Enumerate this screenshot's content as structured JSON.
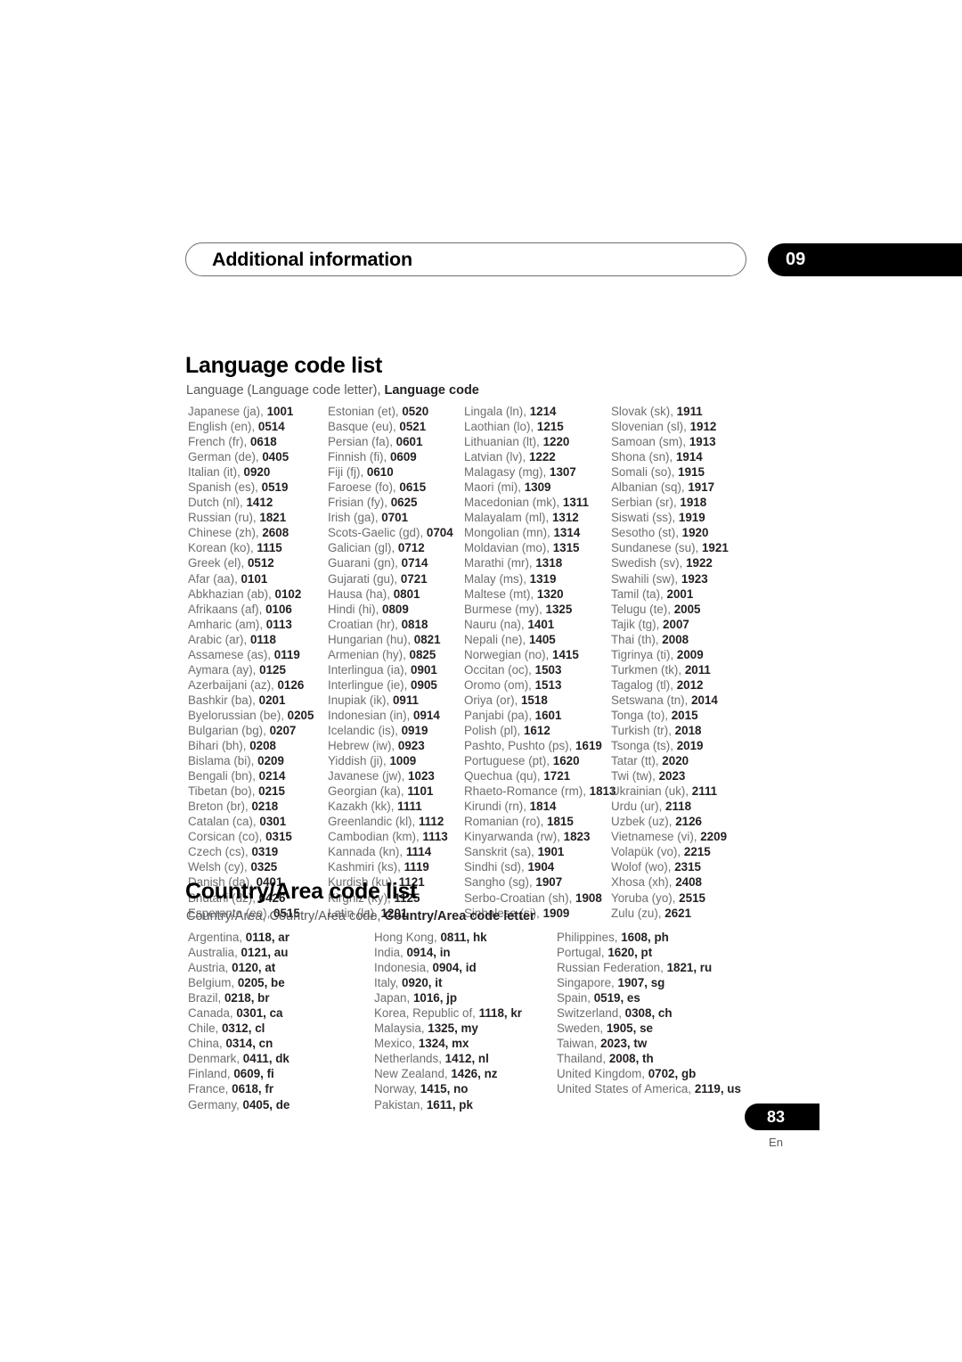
{
  "header": {
    "title": "Additional information",
    "chapter_number": "09"
  },
  "language_section": {
    "heading": "Language code list",
    "subtitle_plain": "Language (Language code letter), ",
    "subtitle_bold": "Language code",
    "columns": [
      [
        {
          "name": "Japanese (ja), ",
          "code": "1001"
        },
        {
          "name": "English (en), ",
          "code": "0514"
        },
        {
          "name": "French (fr), ",
          "code": "0618"
        },
        {
          "name": "German (de), ",
          "code": "0405"
        },
        {
          "name": "Italian (it), ",
          "code": "0920"
        },
        {
          "name": "Spanish (es), ",
          "code": "0519"
        },
        {
          "name": "Dutch (nl), ",
          "code": "1412"
        },
        {
          "name": "Russian (ru), ",
          "code": "1821"
        },
        {
          "name": "Chinese (zh), ",
          "code": "2608"
        },
        {
          "name": "Korean (ko), ",
          "code": "1115"
        },
        {
          "name": "Greek (el), ",
          "code": "0512"
        },
        {
          "name": "Afar (aa), ",
          "code": "0101"
        },
        {
          "name": "Abkhazian (ab), ",
          "code": "0102"
        },
        {
          "name": "Afrikaans (af), ",
          "code": "0106"
        },
        {
          "name": "Amharic (am), ",
          "code": "0113"
        },
        {
          "name": "Arabic (ar), ",
          "code": "0118"
        },
        {
          "name": "Assamese (as), ",
          "code": "0119"
        },
        {
          "name": "Aymara (ay), ",
          "code": "0125"
        },
        {
          "name": "Azerbaijani (az), ",
          "code": "0126"
        },
        {
          "name": "Bashkir (ba), ",
          "code": "0201"
        },
        {
          "name": "Byelorussian (be), ",
          "code": "0205"
        },
        {
          "name": "Bulgarian (bg), ",
          "code": "0207"
        },
        {
          "name": "Bihari (bh), ",
          "code": "0208"
        },
        {
          "name": "Bislama (bi), ",
          "code": "0209"
        },
        {
          "name": "Bengali (bn), ",
          "code": "0214"
        },
        {
          "name": "Tibetan (bo), ",
          "code": "0215"
        },
        {
          "name": "Breton (br), ",
          "code": "0218"
        },
        {
          "name": "Catalan (ca), ",
          "code": "0301"
        },
        {
          "name": "Corsican (co), ",
          "code": "0315"
        },
        {
          "name": "Czech (cs), ",
          "code": "0319"
        },
        {
          "name": "Welsh (cy), ",
          "code": "0325"
        },
        {
          "name": "Danish (da), ",
          "code": "0401"
        },
        {
          "name": "Bhutani (dz), ",
          "code": "0426"
        },
        {
          "name": "Esperanto (eo), ",
          "code": "0515"
        }
      ],
      [
        {
          "name": "Estonian (et), ",
          "code": "0520"
        },
        {
          "name": "Basque (eu), ",
          "code": "0521"
        },
        {
          "name": "Persian (fa), ",
          "code": "0601"
        },
        {
          "name": "Finnish (fi), ",
          "code": "0609"
        },
        {
          "name": "Fiji (fj), ",
          "code": "0610"
        },
        {
          "name": "Faroese (fo), ",
          "code": "0615"
        },
        {
          "name": "Frisian (fy), ",
          "code": "0625"
        },
        {
          "name": "Irish (ga), ",
          "code": "0701"
        },
        {
          "name": "Scots-Gaelic (gd), ",
          "code": "0704"
        },
        {
          "name": "Galician (gl), ",
          "code": "0712"
        },
        {
          "name": "Guarani (gn), ",
          "code": "0714"
        },
        {
          "name": "Gujarati (gu), ",
          "code": "0721"
        },
        {
          "name": "Hausa (ha), ",
          "code": "0801"
        },
        {
          "name": "Hindi (hi), ",
          "code": "0809"
        },
        {
          "name": "Croatian (hr), ",
          "code": "0818"
        },
        {
          "name": "Hungarian (hu), ",
          "code": "0821"
        },
        {
          "name": "Armenian (hy), ",
          "code": "0825"
        },
        {
          "name": "Interlingua (ia), ",
          "code": "0901"
        },
        {
          "name": "Interlingue (ie), ",
          "code": "0905"
        },
        {
          "name": "Inupiak (ik), ",
          "code": "0911"
        },
        {
          "name": "Indonesian (in), ",
          "code": "0914"
        },
        {
          "name": "Icelandic (is), ",
          "code": "0919"
        },
        {
          "name": "Hebrew (iw), ",
          "code": "0923"
        },
        {
          "name": "Yiddish (ji), ",
          "code": "1009"
        },
        {
          "name": "Javanese (jw), ",
          "code": "1023"
        },
        {
          "name": "Georgian (ka), ",
          "code": "1101"
        },
        {
          "name": "Kazakh (kk), ",
          "code": "1111"
        },
        {
          "name": "Greenlandic  (kl), ",
          "code": "1112"
        },
        {
          "name": "Cambodian (km), ",
          "code": "1113"
        },
        {
          "name": "Kannada (kn), ",
          "code": "1114"
        },
        {
          "name": "Kashmiri (ks), ",
          "code": "1119"
        },
        {
          "name": "Kurdish (ku), ",
          "code": "1121"
        },
        {
          "name": "Kirghiz (ky), ",
          "code": "1125"
        },
        {
          "name": "Latin (la), ",
          "code": "1201"
        }
      ],
      [
        {
          "name": "Lingala (ln), ",
          "code": "1214"
        },
        {
          "name": "Laothian (lo), ",
          "code": "1215"
        },
        {
          "name": "Lithuanian (lt), ",
          "code": "1220"
        },
        {
          "name": "Latvian (lv), ",
          "code": "1222"
        },
        {
          "name": "Malagasy (mg), ",
          "code": "1307"
        },
        {
          "name": "Maori (mi), ",
          "code": "1309"
        },
        {
          "name": "Macedonian (mk), ",
          "code": "1311"
        },
        {
          "name": "Malayalam  (ml), ",
          "code": "1312"
        },
        {
          "name": "Mongolian (mn), ",
          "code": "1314"
        },
        {
          "name": "Moldavian (mo), ",
          "code": "1315"
        },
        {
          "name": "Marathi (mr), ",
          "code": "1318"
        },
        {
          "name": "Malay  (ms), ",
          "code": "1319"
        },
        {
          "name": "Maltese (mt), ",
          "code": "1320"
        },
        {
          "name": "Burmese (my), ",
          "code": "1325"
        },
        {
          "name": "Nauru (na), ",
          "code": "1401"
        },
        {
          "name": "Nepali (ne), ",
          "code": "1405"
        },
        {
          "name": "Norwegian (no), ",
          "code": "1415"
        },
        {
          "name": "Occitan (oc), ",
          "code": "1503"
        },
        {
          "name": "Oromo (om), ",
          "code": "1513"
        },
        {
          "name": "Oriya (or), ",
          "code": "1518"
        },
        {
          "name": "Panjabi (pa), ",
          "code": "1601"
        },
        {
          "name": "Polish (pl), ",
          "code": "1612"
        },
        {
          "name": "Pashto, Pushto (ps), ",
          "code": "1619"
        },
        {
          "name": "Portuguese (pt), ",
          "code": "1620"
        },
        {
          "name": "Quechua (qu), ",
          "code": "1721"
        },
        {
          "name": "Rhaeto-Romance (rm), ",
          "code": "1813"
        },
        {
          "name": "Kirundi (rn), ",
          "code": "1814"
        },
        {
          "name": "Romanian (ro), ",
          "code": "1815"
        },
        {
          "name": "Kinyarwanda (rw), ",
          "code": "1823"
        },
        {
          "name": "Sanskrit (sa), ",
          "code": "1901"
        },
        {
          "name": "Sindhi (sd), ",
          "code": "1904"
        },
        {
          "name": "Sangho (sg), ",
          "code": "1907"
        },
        {
          "name": "Serbo-Croatian (sh), ",
          "code": "1908"
        },
        {
          "name": "Sinhalese (si), ",
          "code": "1909"
        }
      ],
      [
        {
          "name": "Slovak (sk), ",
          "code": "1911"
        },
        {
          "name": "Slovenian (sl), ",
          "code": "1912"
        },
        {
          "name": "Samoan (sm), ",
          "code": "1913"
        },
        {
          "name": "Shona (sn), ",
          "code": "1914"
        },
        {
          "name": "Somali (so), ",
          "code": "1915"
        },
        {
          "name": "Albanian (sq), ",
          "code": "1917"
        },
        {
          "name": "Serbian (sr), ",
          "code": "1918"
        },
        {
          "name": "Siswati (ss), ",
          "code": "1919"
        },
        {
          "name": "Sesotho (st), ",
          "code": "1920"
        },
        {
          "name": "Sundanese (su), ",
          "code": "1921"
        },
        {
          "name": "Swedish (sv), ",
          "code": "1922"
        },
        {
          "name": "Swahili (sw), ",
          "code": "1923"
        },
        {
          "name": "Tamil (ta), ",
          "code": "2001"
        },
        {
          "name": "Telugu (te), ",
          "code": "2005"
        },
        {
          "name": "Tajik (tg), ",
          "code": "2007"
        },
        {
          "name": "Thai (th), ",
          "code": "2008"
        },
        {
          "name": "Tigrinya (ti), ",
          "code": "2009"
        },
        {
          "name": "Turkmen (tk), ",
          "code": "2011"
        },
        {
          "name": "Tagalog (tl), ",
          "code": "2012"
        },
        {
          "name": "Setswana (tn), ",
          "code": "2014"
        },
        {
          "name": "Tonga (to), ",
          "code": "2015"
        },
        {
          "name": "Turkish (tr), ",
          "code": "2018"
        },
        {
          "name": "Tsonga (ts), ",
          "code": "2019"
        },
        {
          "name": "Tatar (tt), ",
          "code": "2020"
        },
        {
          "name": "Twi (tw), ",
          "code": "2023"
        },
        {
          "name": "Ukrainian (uk), ",
          "code": "2111"
        },
        {
          "name": "Urdu (ur), ",
          "code": "2118"
        },
        {
          "name": "Uzbek (uz), ",
          "code": "2126"
        },
        {
          "name": "Vietnamese (vi), ",
          "code": "2209"
        },
        {
          "name": "Volapük (vo), ",
          "code": "2215"
        },
        {
          "name": "Wolof (wo), ",
          "code": "2315"
        },
        {
          "name": "Xhosa (xh), ",
          "code": "2408"
        },
        {
          "name": "Yoruba (yo), ",
          "code": "2515"
        },
        {
          "name": "Zulu (zu), ",
          "code": "2621"
        }
      ]
    ]
  },
  "country_section": {
    "heading": "Country/Area code list",
    "subtitle_plain": "Country/Area, Country/Area code, ",
    "subtitle_bold": "Country/Area code letter",
    "columns": [
      [
        {
          "name": "Argentina, ",
          "code": "0118, ar"
        },
        {
          "name": "Australia, ",
          "code": "0121, au"
        },
        {
          "name": "Austria, ",
          "code": "0120, at"
        },
        {
          "name": "Belgium, ",
          "code": "0205, be"
        },
        {
          "name": "Brazil, ",
          "code": "0218, br"
        },
        {
          "name": "Canada, ",
          "code": "0301, ca"
        },
        {
          "name": "Chile, ",
          "code": "0312, cl"
        },
        {
          "name": "China, ",
          "code": "0314, cn"
        },
        {
          "name": "Denmark, ",
          "code": "0411, dk"
        },
        {
          "name": "Finland, ",
          "code": "0609, fi"
        },
        {
          "name": "France, ",
          "code": "0618, fr"
        },
        {
          "name": "Germany, ",
          "code": "0405, de"
        }
      ],
      [
        {
          "name": "Hong Kong, ",
          "code": "0811, hk"
        },
        {
          "name": "India, ",
          "code": "0914, in"
        },
        {
          "name": "Indonesia, ",
          "code": "0904, id"
        },
        {
          "name": "Italy, ",
          "code": "0920, it"
        },
        {
          "name": "Japan, ",
          "code": "1016, jp"
        },
        {
          "name": "Korea, Republic of, ",
          "code": "1118, kr"
        },
        {
          "name": "Malaysia, ",
          "code": "1325, my"
        },
        {
          "name": "Mexico, ",
          "code": "1324, mx"
        },
        {
          "name": "Netherlands, ",
          "code": "1412, nl"
        },
        {
          "name": "New Zealand, ",
          "code": "1426, nz"
        },
        {
          "name": "Norway, ",
          "code": "1415, no"
        },
        {
          "name": "Pakistan, ",
          "code": "1611, pk"
        }
      ],
      [
        {
          "name": "Philippines, ",
          "code": "1608, ph"
        },
        {
          "name": "Portugal, ",
          "code": "1620, pt"
        },
        {
          "name": "Russian Federation, ",
          "code": "1821, ru"
        },
        {
          "name": "Singapore, ",
          "code": "1907, sg"
        },
        {
          "name": "Spain, ",
          "code": "0519, es"
        },
        {
          "name": "Switzerland, ",
          "code": "0308, ch"
        },
        {
          "name": "Sweden, ",
          "code": "1905, se"
        },
        {
          "name": "Taiwan, ",
          "code": "2023, tw"
        },
        {
          "name": "Thailand, ",
          "code": "2008, th"
        },
        {
          "name": "United Kingdom, ",
          "code": "0702, gb"
        },
        {
          "name": "United States of America, ",
          "code": "2119, us"
        }
      ]
    ]
  },
  "footer": {
    "page_number": "83",
    "language_indicator": "En"
  }
}
